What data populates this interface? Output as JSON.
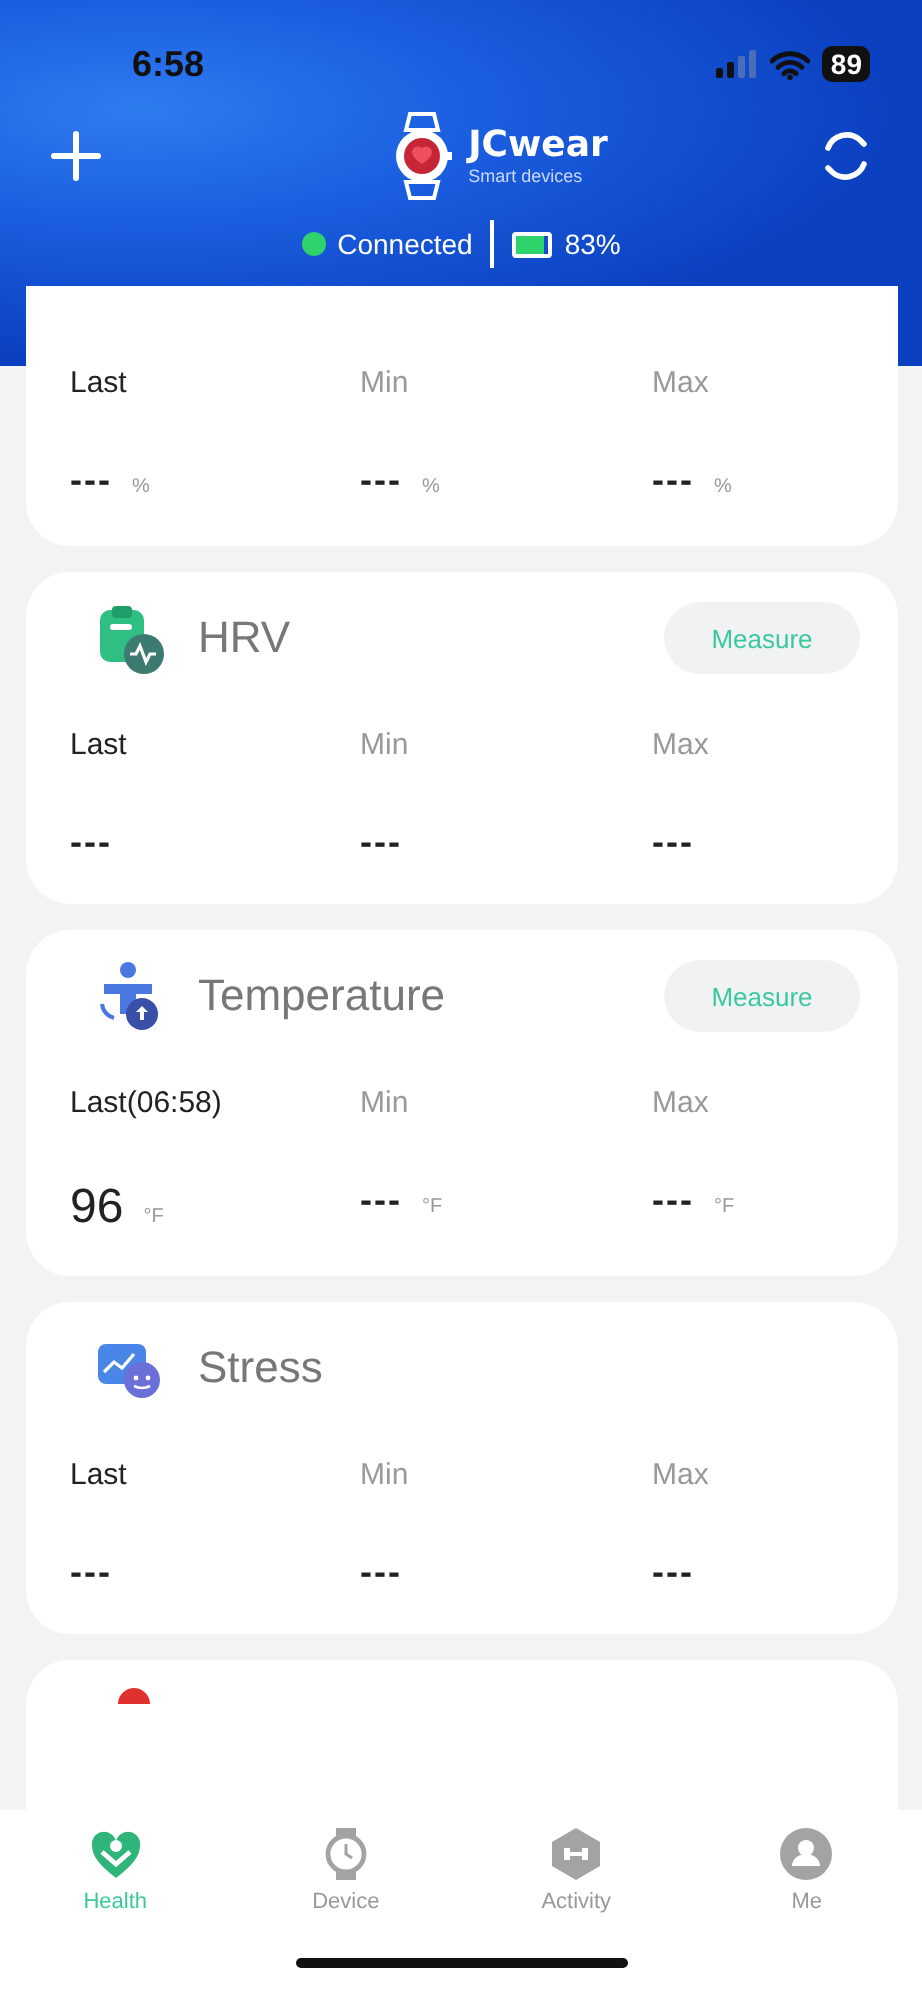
{
  "status_bar": {
    "time": "6:58",
    "battery": "89"
  },
  "header": {
    "brand": "JCwear",
    "subtitle": "Smart devices",
    "connection": {
      "label": "Connected",
      "connected": true
    },
    "device_battery": {
      "label": "83%",
      "level": 0.83
    }
  },
  "cards": [
    {
      "kind": "continued",
      "stats": [
        {
          "label": "Last",
          "value": "---",
          "unit": "%"
        },
        {
          "label": "Min",
          "value": "---",
          "unit": "%"
        },
        {
          "label": "Max",
          "value": "---",
          "unit": "%"
        }
      ]
    },
    {
      "kind": "metric",
      "title": "HRV",
      "button": "Measure",
      "stats": [
        {
          "label": "Last",
          "value": "---"
        },
        {
          "label": "Min",
          "value": "---"
        },
        {
          "label": "Max",
          "value": "---"
        }
      ]
    },
    {
      "kind": "metric",
      "title": "Temperature",
      "button": "Measure",
      "stats": [
        {
          "label": "Last(06:58)",
          "value": "96",
          "unit": "°F"
        },
        {
          "label": "Min",
          "value": "---",
          "unit": "°F"
        },
        {
          "label": "Max",
          "value": "---",
          "unit": "°F"
        }
      ]
    },
    {
      "kind": "metric",
      "title": "Stress",
      "stats": [
        {
          "label": "Last",
          "value": "---"
        },
        {
          "label": "Min",
          "value": "---"
        },
        {
          "label": "Max",
          "value": "---"
        }
      ]
    },
    {
      "kind": "peek"
    }
  ],
  "tabs": [
    {
      "label": "Health",
      "selected": true
    },
    {
      "label": "Device",
      "selected": false
    },
    {
      "label": "Activity",
      "selected": false
    },
    {
      "label": "Me",
      "selected": false
    }
  ]
}
